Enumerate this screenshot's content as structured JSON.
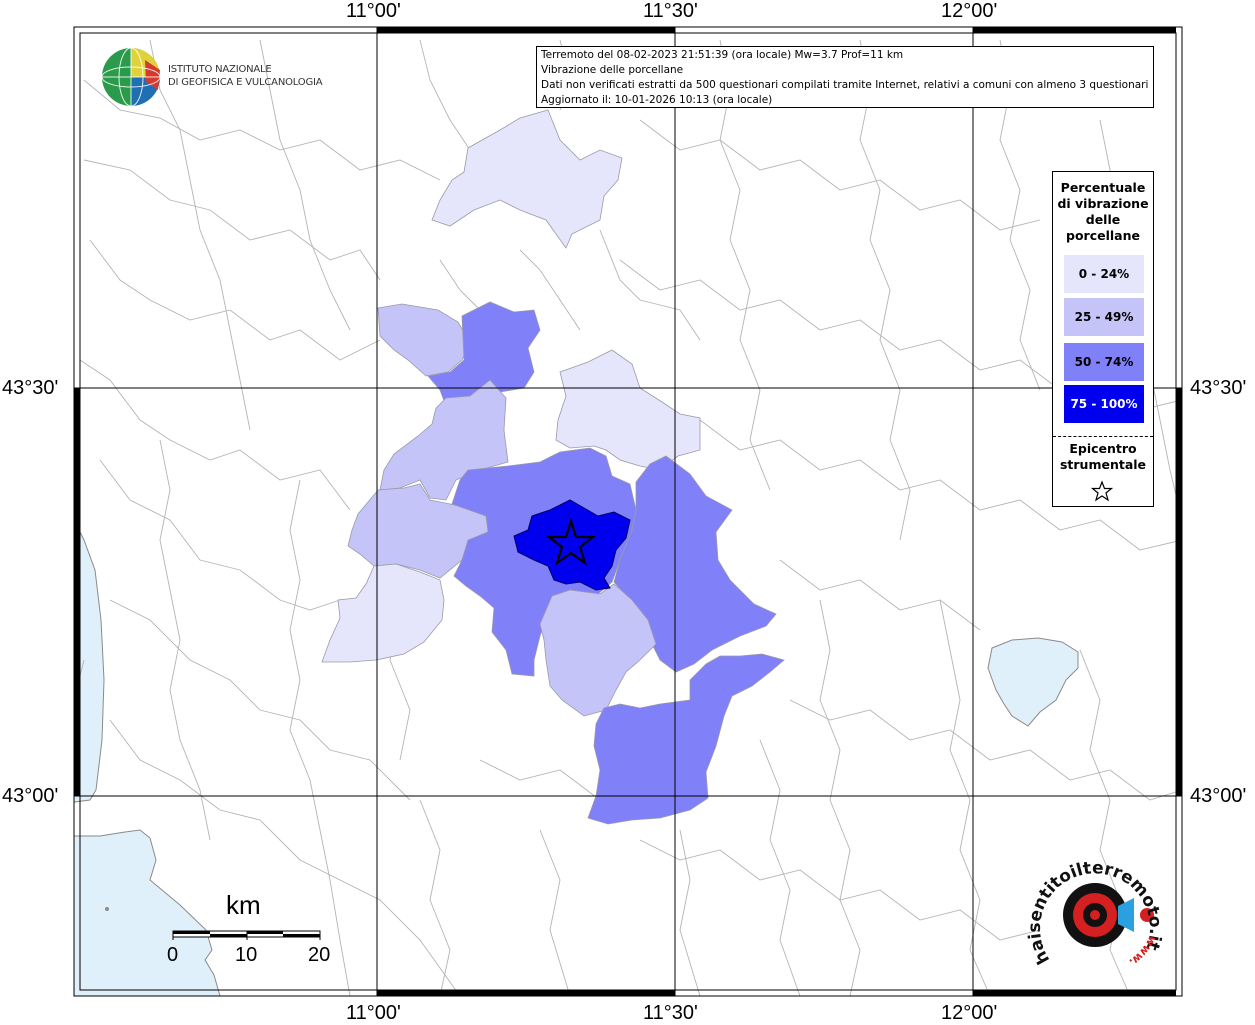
{
  "map": {
    "lon_labels_top": [
      "11°00'",
      "11°30'",
      "12°00'"
    ],
    "lon_labels_bottom": [
      "11°00'",
      "11°30'",
      "12°00'"
    ],
    "lat_labels_left": [
      "43°30'",
      "43°00'"
    ],
    "lat_labels_right": [
      "43°30'",
      "43°00'"
    ]
  },
  "info": {
    "line1": "Terremoto del 08-02-2023 21:51:39 (ora locale) Mw=3.7 Prof=11 km",
    "line2": "Vibrazione delle porcellane",
    "line3": "Dati non verificati estratti da 500 questionari compilati tramite Internet, relativi a comuni con almeno 3 questionari.",
    "line4": "Aggiornato il: 10-01-2026 10:13 (ora locale)"
  },
  "legend": {
    "title_lines": [
      "Percentuale",
      "di vibrazione",
      "delle",
      "porcellane"
    ],
    "classes": [
      {
        "label": "0 - 24%",
        "color": "#e5e5fb"
      },
      {
        "label": "25 - 49%",
        "color": "#c4c4f8"
      },
      {
        "label": "50 - 74%",
        "color": "#8080f8"
      },
      {
        "label": "75 - 100%",
        "color": "#0000ee"
      }
    ],
    "epicenter_lines": [
      "Epicentro",
      "strumentale"
    ]
  },
  "logo_ingv": {
    "line1": "ISTITUTO NAZIONALE",
    "line2": "DI GEOFISICA E VULCANOLOGIA"
  },
  "logo_hst": {
    "text": "haisentitoilterremoto.it",
    "url_text": "www."
  },
  "scale": {
    "unit": "km",
    "ticks": [
      "0",
      "10",
      "20"
    ]
  },
  "colors": {
    "sea": "#dff0fb",
    "border": "#b4b4b4",
    "grid": "#000000"
  }
}
